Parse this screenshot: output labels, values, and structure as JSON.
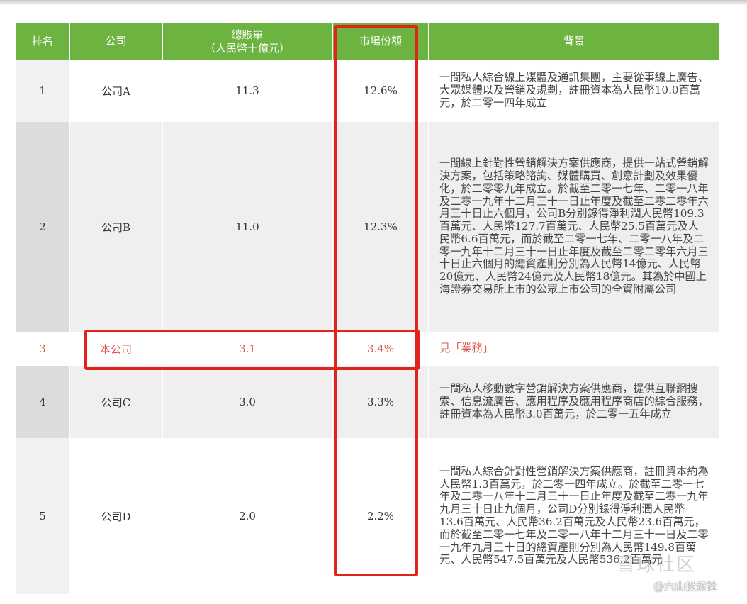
{
  "header": {
    "rank": "排名",
    "company": "公司",
    "billing_line1": "總賬單",
    "billing_line2": "（人民幣十億元）",
    "share": "市場份額",
    "background": "背景"
  },
  "rows": [
    {
      "rank": "1",
      "company": "公司A",
      "billing": "11.3",
      "share": "12.6%",
      "background": "一間私人綜合線上媒體及通訊集團，主要從事線上廣告、大眾媒體以及營銷及規劃，註冊資本為人民幣10.0百萬元，於二零一四年成立"
    },
    {
      "rank": "2",
      "company": "公司B",
      "billing": "11.0",
      "share": "12.3%",
      "background": "一間線上針對性營銷解決方案供應商，提供一站式營銷解決方案，包括策略諮詢、媒體購買、創意計劃及效果優化，於二零零九年成立。於截至二零一七年、二零一八年及二零一九年十二月三十一日止年度及截至二零二零年六月三十日止六個月，公司B分別錄得淨利潤人民幣109.3百萬元、人民幣127.7百萬元、人民幣25.5百萬元及人民幣6.6百萬元，而於截至二零一七年、二零一八年及二零一九年十二月三十一日止年度及截至二零二零年六月三十日止六個月的總資產則分別為人民幣14億元、人民幣20億元、人民幣24億元及人民幣18億元。其為於中國上海證券交易所上市的公眾上市公司的全資附屬公司"
    },
    {
      "rank": "3",
      "company": "本公司",
      "billing": "3.1",
      "share": "3.4%",
      "background": "見「業務」"
    },
    {
      "rank": "4",
      "company": "公司C",
      "billing": "3.0",
      "share": "3.3%",
      "background": "一間私人移動數字營銷解決方案供應商，提供互聯網搜索、信息流廣告、應用程序及應用程序商店的綜合服務，註冊資本為人民幣3.0百萬元，於二零一五年成立"
    },
    {
      "rank": "5",
      "company": "公司D",
      "billing": "2.0",
      "share": "2.2%",
      "background": "一間私人綜合針對性營銷解決方案供應商，註冊資本約為人民幣1.3百萬元，於二零一四年成立。於截至二零一七年及二零一八年十二月三十一日止年度及截至二零一九年九月三十日止九個月，公司D分別錄得淨利潤人民幣13.6百萬元、人民幣36.2百萬元及人民幣23.6百萬元，而於截至二零一七年及二零一八年十二月三十一日及二零一九年九月三十日的總資產則分別為人民幣149.8百萬元、人民幣547.5百萬元及人民幣536.2百萬元"
    }
  ],
  "watermark": {
    "large": "雪球社区",
    "small": "@六山投资社"
  },
  "colors": {
    "header_bg": "#6db33f",
    "highlight_text": "#e0564a",
    "annotation_box": "#e2231a"
  }
}
